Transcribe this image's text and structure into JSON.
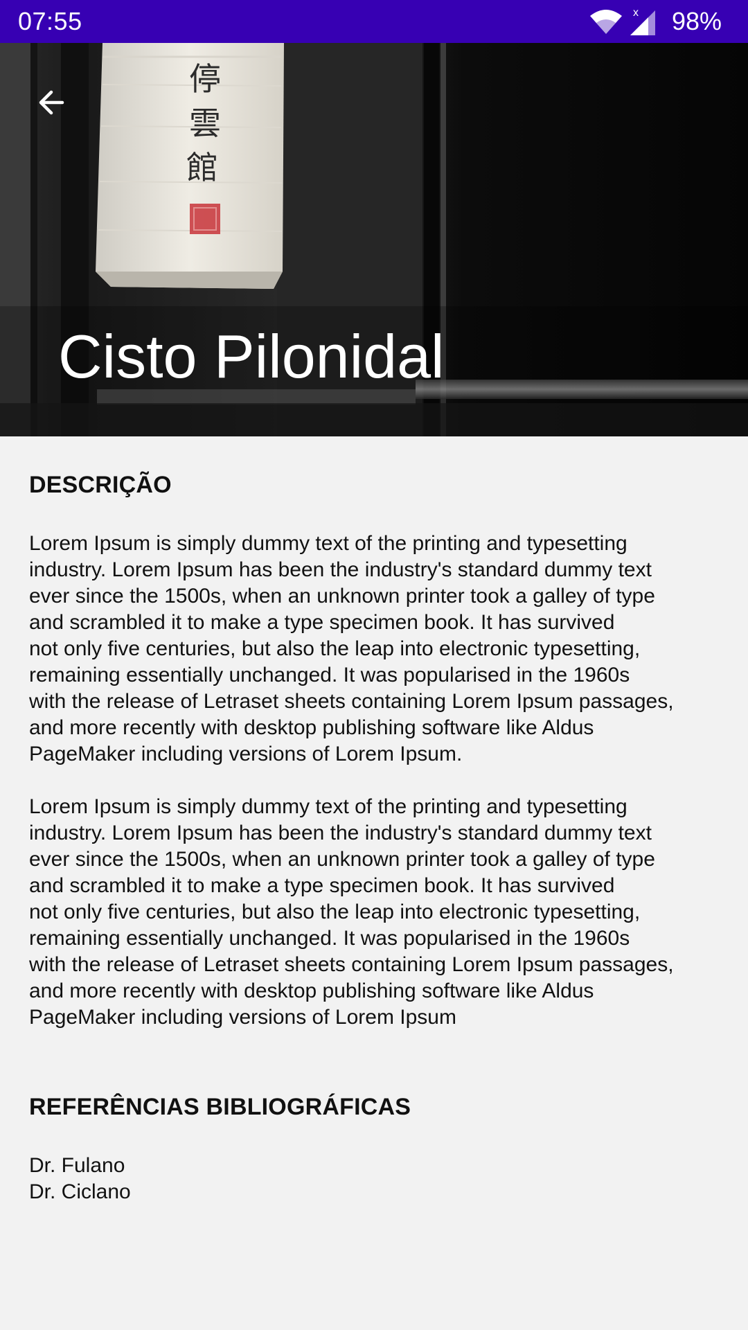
{
  "status_bar": {
    "time": "07:55",
    "battery": "98%",
    "icons": [
      "wifi-icon",
      "cellular-signal-icon"
    ]
  },
  "header": {
    "title": "Cisto Pilonidal",
    "back_icon": "arrow-back-icon",
    "image": "paper-lantern-photo",
    "lantern_characters": "停雲館"
  },
  "description": {
    "heading": "DESCRIÇÃO",
    "paragraphs": [
      "Lorem Ipsum is simply dummy text of the printing and typesetting\nindustry. Lorem Ipsum has been the industry's standard dummy text\never since the 1500s, when an unknown printer took a galley of type\nand scrambled it to make a type specimen book. It has survived\nnot only five centuries, but also the leap into electronic typesetting,\nremaining essentially unchanged. It was popularised in the 1960s\nwith the release of Letraset sheets containing Lorem Ipsum passages,\nand more recently with desktop publishing software like Aldus\nPageMaker including versions of Lorem Ipsum.",
      "Lorem Ipsum is simply dummy text of the printing and typesetting\nindustry. Lorem Ipsum has been the industry's standard dummy text\never since the 1500s, when an unknown printer took a galley of type\nand scrambled it to make a type specimen book. It has survived\nnot only five centuries, but also the leap into electronic typesetting,\nremaining essentially unchanged. It was popularised in the 1960s\nwith the release of Letraset sheets containing Lorem Ipsum passages,\nand more recently with desktop publishing software like Aldus\nPageMaker including versions of Lorem Ipsum"
    ]
  },
  "references": {
    "heading": "REFERÊNCIAS BIBLIOGRÁFICAS",
    "items": [
      "Dr. Fulano",
      "Dr. Ciclano"
    ]
  },
  "colors": {
    "status_bar": "#3700b3",
    "background": "#f2f2f2",
    "text": "#111111",
    "title": "#ffffff"
  }
}
